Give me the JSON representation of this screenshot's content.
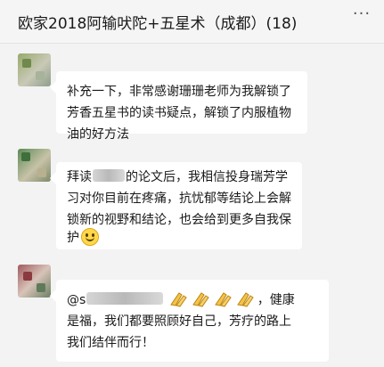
{
  "header": {
    "title": "欧家2018阿输吠陀+五星术（成都）(18)",
    "more_glyph": "···"
  },
  "messages": [
    {
      "lines": [
        "补充一下，非常感谢珊珊老师为我解锁了",
        "芳香五星书的读书疑点，解锁了内服植物",
        "油的好方法"
      ]
    },
    {
      "line1_prefix": "拜读",
      "line1_suffix": "的论文后，我相信投身瑞芳学",
      "lines_rest": [
        "习对你目前在疼痛，抗忧郁等结论上会解",
        "锁新的视野和结论，也会给到更多自我保"
      ],
      "last_line": "护",
      "emoji": "smile-emoji"
    },
    {
      "mention_prefix": "@s",
      "after_emojis": "，健康",
      "emojis": [
        "clap-emoji",
        "clap-emoji",
        "clap-emoji",
        "clap-emoji"
      ],
      "lines_rest": [
        "是福，我们都要照顾好自己，芳疗的路上",
        "我们结伴而行！"
      ]
    }
  ],
  "colors": {
    "window_bg": "#f3f3f3",
    "bubble_bg": "#ffffff",
    "emoji_yellow": "#ffd84a"
  }
}
